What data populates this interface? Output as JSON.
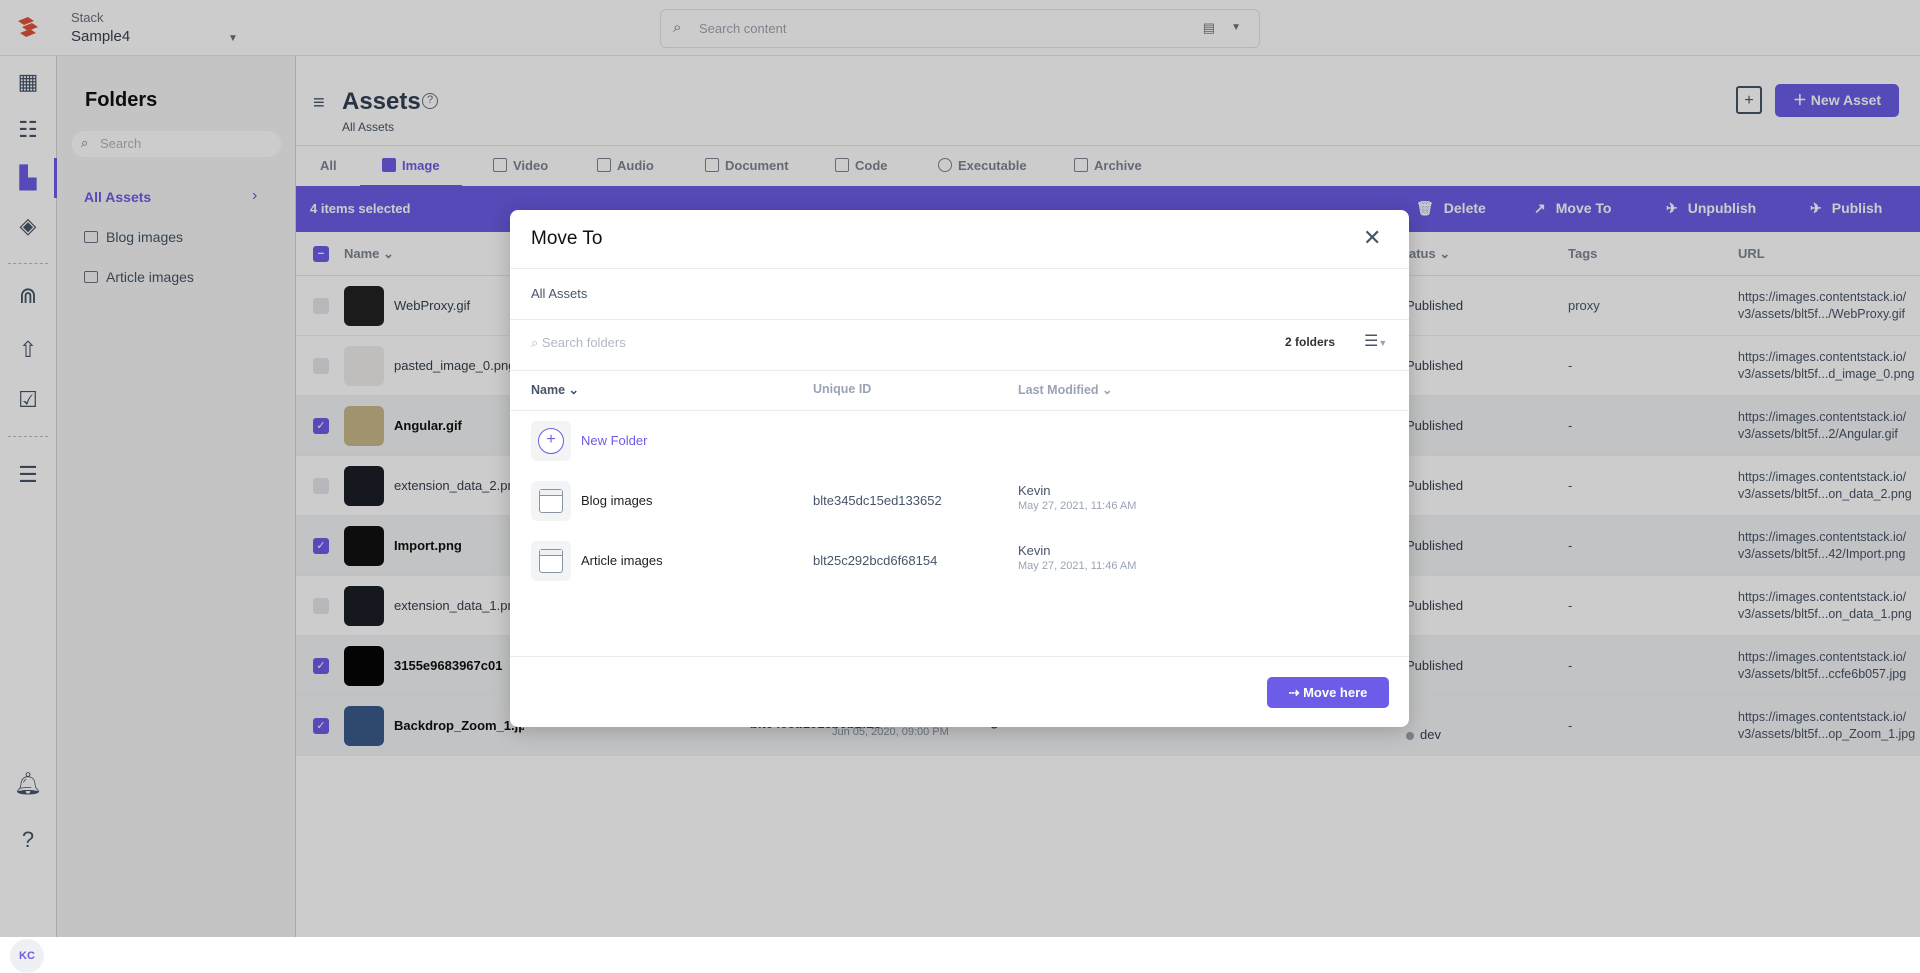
{
  "topbar": {
    "stack_label": "Stack",
    "stack_name": "Sample4",
    "search_placeholder": "Search content"
  },
  "nav": {
    "avatar_initials": "KC"
  },
  "folders": {
    "title": "Folders",
    "search_placeholder": "Search",
    "items": [
      {
        "label": "All Assets"
      },
      {
        "label": "Blog images"
      },
      {
        "label": "Article images"
      }
    ]
  },
  "header": {
    "title": "Assets",
    "breadcrumb": "All Assets",
    "new_asset_label": "New Asset"
  },
  "tabs": [
    {
      "label": "All"
    },
    {
      "label": "Image"
    },
    {
      "label": "Video"
    },
    {
      "label": "Audio"
    },
    {
      "label": "Document"
    },
    {
      "label": "Code"
    },
    {
      "label": "Executable"
    },
    {
      "label": "Archive"
    }
  ],
  "bulk": {
    "count_label": "4 items selected",
    "delete": "Delete",
    "move_to": "Move To",
    "unpublish": "Unpublish",
    "publish": "Publish"
  },
  "table": {
    "headers": {
      "name": "Name",
      "status": "Status",
      "tags": "Tags",
      "url": "URL"
    },
    "rows": [
      {
        "name": "WebProxy.gif",
        "selected": false,
        "status": "Published",
        "tags": "proxy",
        "url1": "https://images.contentstack.io/",
        "url2": "v3/assets/blt5f.../WebProxy.gif"
      },
      {
        "name": "pasted_image_0.png",
        "selected": false,
        "status": "Published",
        "tags": "-",
        "url1": "https://images.contentstack.io/",
        "url2": "v3/assets/blt5f...d_image_0.png"
      },
      {
        "name": "Angular.gif",
        "selected": true,
        "status": "Published",
        "tags": "-",
        "url1": "https://images.contentstack.io/",
        "url2": "v3/assets/blt5f...2/Angular.gif"
      },
      {
        "name": "extension_data_2.png",
        "selected": false,
        "status": "Published",
        "tags": "-",
        "url1": "https://images.contentstack.io/",
        "url2": "v3/assets/blt5f...on_data_2.png"
      },
      {
        "name": "Import.png",
        "selected": true,
        "status": "Published",
        "tags": "-",
        "url1": "https://images.contentstack.io/",
        "url2": "v3/assets/blt5f...42/Import.png"
      },
      {
        "name": "extension_data_1.png",
        "selected": false,
        "status": "Published",
        "tags": "-",
        "url1": "https://images.contentstack.io/",
        "url2": "v3/assets/blt5f...on_data_1.png"
      },
      {
        "name": "3155e9683967c01",
        "selected": true,
        "status": "Published",
        "tags": "-",
        "url1": "https://images.contentstack.io/",
        "url2": "v3/assets/blt5f...ccfe6b057.jpg"
      },
      {
        "name": "Backdrop_Zoom_1.jpg",
        "selected": true,
        "uid": "blt0408d101eb0b2f26",
        "modified": "Jun 05, 2020, 09:00 PM",
        "type": "image",
        "env": "dev",
        "tags": "-",
        "url1": "https://images.contentstack.io/",
        "url2": "v3/assets/blt5f...op_Zoom_1.jpg"
      }
    ]
  },
  "modal": {
    "title": "Move To",
    "breadcrumb": "All Assets",
    "search_placeholder": "Search folders",
    "count": "2 folders",
    "headers": {
      "name": "Name",
      "uid": "Unique ID",
      "modified": "Last Modified"
    },
    "new_folder": "New Folder",
    "folders": [
      {
        "name": "Blog images",
        "uid": "blte345dc15ed133652",
        "by": "Kevin",
        "date": "May 27, 2021, 11:46 AM"
      },
      {
        "name": "Article images",
        "uid": "blt25c292bcd6f68154",
        "by": "Kevin",
        "date": "May 27, 2021, 11:46 AM"
      }
    ],
    "move_here": "Move here"
  },
  "colors": {
    "accent": "#6c5ce7"
  }
}
